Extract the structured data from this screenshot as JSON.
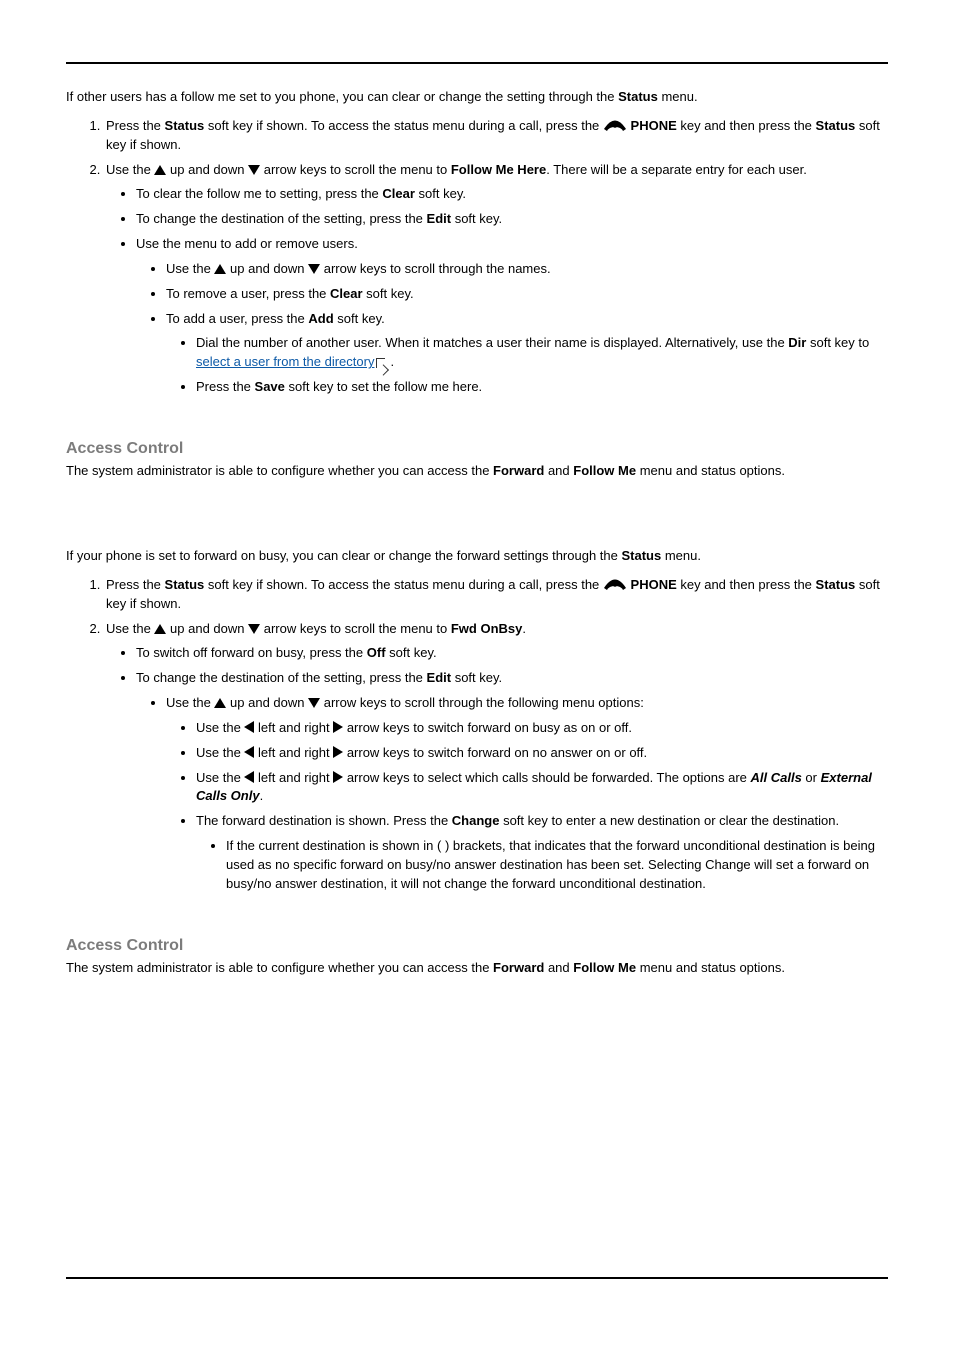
{
  "section1": {
    "intro_pre": "If other users has a follow me set to you phone, you can clear or change the setting through the ",
    "intro_bold": "Status",
    "intro_post": " menu.",
    "step1_a": "Press the ",
    "step1_b": "Status",
    "step1_c": " soft key if shown. To access the status menu during a call, press the ",
    "step1_d": "PHONE",
    "step1_e": " key and then press the ",
    "step1_f": "Status",
    "step1_g": " soft key if shown.",
    "step2_a": "Use the ",
    "step2_b": " up and down ",
    "step2_c": " arrow keys to scroll the menu to ",
    "step2_d": "Follow Me Here",
    "step2_e": ". There will be a separate entry for each user.",
    "b1_a": "To clear the follow me to setting, press the ",
    "b1_b": "Clear",
    "b1_c": " soft key.",
    "b2_a": "To change the destination of the setting, press the ",
    "b2_b": "Edit",
    "b2_c": " soft key.",
    "b3": "Use the menu to add or remove users.",
    "b3_1_a": "Use the ",
    "b3_1_b": " up and down ",
    "b3_1_c": " arrow keys to scroll through the names.",
    "b3_2_a": "To remove a user, press the ",
    "b3_2_b": "Clear",
    "b3_2_c": " soft key.",
    "b3_3_a": "To add a user, press the ",
    "b3_3_b": "Add",
    "b3_3_c": " soft key.",
    "b3_3_1_a": "Dial the number of another user. When it matches a user their name is displayed.  Alternatively, use the ",
    "b3_3_1_b": "Dir",
    "b3_3_1_c": " soft key to ",
    "b3_3_1_link": "select a user from the directory",
    "b3_3_1_d": ".",
    "b3_3_2_a": "Press the ",
    "b3_3_2_b": "Save",
    "b3_3_2_c": " soft key to set the follow me here."
  },
  "access1": {
    "heading": "Access Control",
    "pre": "The system administrator is able to configure whether you can access the ",
    "b1": "Forward",
    "mid": " and ",
    "b2": "Follow Me",
    "post": " menu and status options."
  },
  "section2": {
    "intro_pre": "If your phone is set to forward on busy, you can clear or change the forward settings through the ",
    "intro_bold": "Status",
    "intro_post": " menu.",
    "step1_a": "Press the ",
    "step1_b": "Status",
    "step1_c": " soft key if shown. To access the status menu during a call, press the ",
    "step1_d": "PHONE",
    "step1_e": " key and then press the ",
    "step1_f": "Status",
    "step1_g": " soft key if shown.",
    "step2_a": "Use the ",
    "step2_b": " up and down ",
    "step2_c": " arrow keys to scroll the menu to ",
    "step2_d": "Fwd OnBsy",
    "step2_e": ".",
    "b1_a": "To switch off forward on busy, press the ",
    "b1_b": "Off",
    "b1_c": " soft key.",
    "b2_a": "To change the destination of the setting, press the ",
    "b2_b": "Edit",
    "b2_c": " soft key.",
    "b2_1_a": "Use the ",
    "b2_1_b": " up and down ",
    "b2_1_c": " arrow keys to scroll through the following menu options:",
    "b2_1_1_a": "Use the ",
    "b2_1_1_b": " left and right ",
    "b2_1_1_c": " arrow keys to switch forward on busy as on or off.",
    "b2_1_2_a": "Use the ",
    "b2_1_2_b": " left and right ",
    "b2_1_2_c": " arrow keys to switch forward on no answer on or off.",
    "b2_1_3_a": "Use the ",
    "b2_1_3_b": " left and right ",
    "b2_1_3_c": " arrow keys to select which calls should be forwarded. The options are ",
    "b2_1_3_d": "All Calls",
    "b2_1_3_e": " or ",
    "b2_1_3_f": "External Calls Only",
    "b2_1_3_g": ".",
    "b2_1_4_a": "The forward destination is shown. Press the ",
    "b2_1_4_b": "Change",
    "b2_1_4_c": " soft key to enter a new destination or clear the destination.",
    "b2_1_4_1": "If the current destination is shown in ( ) brackets, that indicates that the forward unconditional destination is being used as no specific forward on busy/no answer destination has been set. Selecting Change will set a forward on busy/no answer destination, it will not change the forward unconditional destination."
  },
  "access2": {
    "heading": "Access Control",
    "pre": "The system administrator is able to configure whether you can access the ",
    "b1": "Forward",
    "mid": " and ",
    "b2": "Follow Me",
    "post": " menu and status options."
  }
}
